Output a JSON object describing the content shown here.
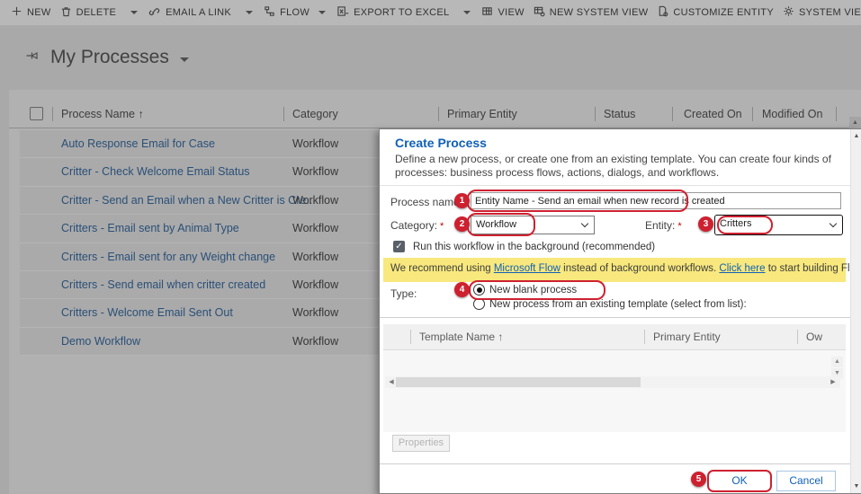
{
  "colors": {
    "annotation": "#ce2130",
    "accent_blue": "#1160b7",
    "banner_yellow": "#f8e87d"
  },
  "toolbar": {
    "items": [
      {
        "label": "NEW",
        "icon": "plus-icon"
      },
      {
        "label": "DELETE",
        "icon": "trash-icon",
        "has_caret": true
      },
      {
        "label": "EMAIL A LINK",
        "icon": "link-icon",
        "has_caret": true
      },
      {
        "label": "FLOW",
        "icon": "flow-icon",
        "has_caret": true
      },
      {
        "label": "EXPORT TO EXCEL",
        "icon": "excel-icon",
        "has_caret": true
      },
      {
        "label": "VIEW",
        "icon": "view-grid-icon"
      },
      {
        "label": "NEW SYSTEM VIEW",
        "icon": "table-gear-icon"
      },
      {
        "label": "CUSTOMIZE ENTITY",
        "icon": "page-gear-icon"
      },
      {
        "label": "SYSTEM VIEWS",
        "icon": "gear-icon"
      }
    ]
  },
  "page": {
    "title": "My Processes"
  },
  "grid": {
    "columns": [
      "Process Name",
      "Category",
      "Primary Entity",
      "Status",
      "Created On",
      "Modified On"
    ],
    "sort_indicator": "↑",
    "rows": [
      {
        "name": "Auto Response Email for Case",
        "category": "Workflow"
      },
      {
        "name": "Critter - Check Welcome Email Status",
        "category": "Workflow"
      },
      {
        "name": "Critter - Send an Email when a New Critter is Cre...",
        "category": "Workflow"
      },
      {
        "name": "Critters - Email sent by Animal Type",
        "category": "Workflow"
      },
      {
        "name": "Critters - Email sent for any Weight change",
        "category": "Workflow"
      },
      {
        "name": "Critters - Send email when critter created",
        "category": "Workflow"
      },
      {
        "name": "Critters - Welcome Email Sent Out",
        "category": "Workflow"
      },
      {
        "name": "Demo Workflow",
        "category": "Workflow"
      }
    ]
  },
  "dialog": {
    "title": "Create Process",
    "description": "Define a new process, or create one from an existing template. You can create four kinds of processes: business process flows, actions, dialogs, and workflows.",
    "process_name": {
      "label": "Process name:",
      "required": "*",
      "value": "Entity Name - Send an email when new record is created"
    },
    "category": {
      "label": "Category:",
      "required": "*",
      "value": "Workflow"
    },
    "entity": {
      "label": "Entity:",
      "required": "*",
      "value": "Critters"
    },
    "background_checkbox": {
      "label": "Run this workflow in the background (recommended)",
      "checked": true,
      "check_glyph": "✓"
    },
    "banner": {
      "text_before": "We recommend using ",
      "link_flow": "Microsoft Flow",
      "text_middle": " instead of background workflows. ",
      "link_click": "Click here",
      "text_after": " to start building Flows!"
    },
    "type": {
      "label": "Type:",
      "option_blank": "New blank process",
      "option_template": "New process from an existing template (select from list):",
      "selected": "New blank process"
    },
    "template_grid": {
      "columns": [
        "Template Name",
        "Primary Entity",
        "Ow"
      ],
      "sort_indicator": "↑"
    },
    "properties_button": "Properties",
    "ok_button": "OK",
    "cancel_button": "Cancel"
  },
  "annotations": {
    "color": "#ce2130",
    "steps": [
      "1",
      "2",
      "3",
      "4",
      "5"
    ]
  },
  "scroll": {
    "up": "▲",
    "down": "▼",
    "left": "◀",
    "right": "▶"
  }
}
